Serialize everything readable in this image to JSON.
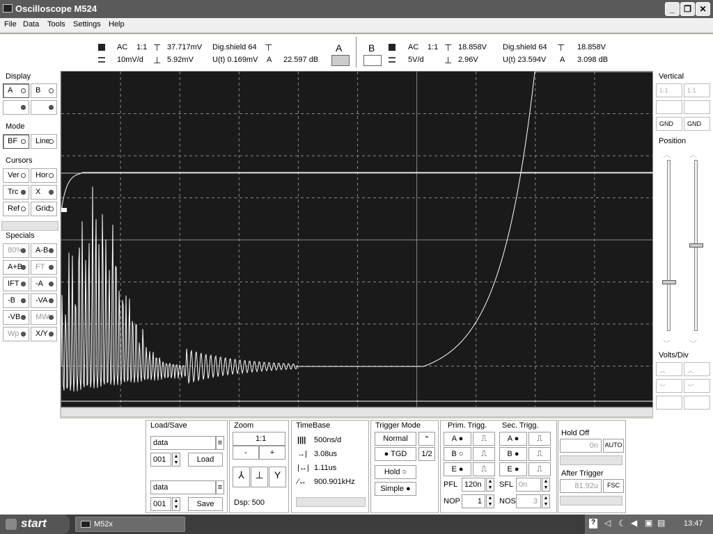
{
  "window": {
    "title": "Oscilloscope M524",
    "minimize": "_",
    "maximize": "❐",
    "close": "✕"
  },
  "menu": [
    "File",
    "Data",
    "Tools",
    "Settings",
    "Help"
  ],
  "channel_a": {
    "coupling": "AC",
    "ratio": "1:1",
    "vpp": "37.717mV",
    "shield": "Dig.shield 64",
    "volts_div": "10mV/d",
    "vrms": "5.92mV",
    "ut": "U(t) 0.169mV",
    "a_label": "A",
    "db": "22.597 dB",
    "box_label": "A"
  },
  "channel_b": {
    "box_label": "B",
    "coupling": "AC",
    "ratio": "1:1",
    "vpp": "18.858V",
    "shield": "Dig.shield 64",
    "vmax": "18.858V",
    "volts_div": "5V/d",
    "vrms": "2.96V",
    "ut": "U(t) 23.594V",
    "a_label": "A",
    "db": "3.098 dB"
  },
  "left": {
    "display": {
      "title": "Display",
      "a": "A",
      "b": "B"
    },
    "mode": {
      "title": "Mode",
      "bf": "BF",
      "line": "Line"
    },
    "cursors": {
      "title": "Cursors",
      "ver": "Ver",
      "hor": "Hor",
      "trc": "Trc",
      "x": "X",
      "ref": "Ref",
      "grid": "Grid"
    },
    "specials": {
      "title": "Specials",
      "items": [
        "80%",
        "A-B",
        "A+B",
        "FT",
        "IFT",
        "-A",
        "-B",
        "-VA",
        "-VB",
        "MW",
        "Wp",
        "X/Y"
      ]
    }
  },
  "right": {
    "vertical": {
      "title": "Vertical",
      "r1a": "1:1",
      "r1b": "1:1",
      "gnd_a": "GND",
      "gnd_b": "GND"
    },
    "position": {
      "title": "Position",
      "slider_a": 0.72,
      "slider_b": 0.5
    },
    "volts_div": {
      "title": "Volts/Div"
    }
  },
  "loadsave": {
    "title": "Load/Save",
    "file1": "data",
    "num1": "001",
    "load": "Load",
    "file2": "data",
    "num2": "001",
    "save": "Save"
  },
  "zoom": {
    "title": "Zoom",
    "ratio": "1:1",
    "minus": "-",
    "plus": "+",
    "dsp": "Dsp: 500"
  },
  "timebase": {
    "title": "TimeBase",
    "per_div": "500ns/d",
    "t1": "3.08us",
    "t2": "1.11us",
    "freq": "900.901kHz"
  },
  "trigger_mode": {
    "title": "Trigger Mode",
    "normal": "Normal",
    "tgd": "TGD",
    "half": "1/2",
    "hold": "Hold",
    "simple": "Simple"
  },
  "prim_trigg": {
    "title": "Prim. Trigg.",
    "a": "A",
    "b": "B",
    "e": "E",
    "pfl_label": "PFL",
    "pfl": "120n",
    "nop_label": "NOP",
    "nop": "1"
  },
  "sec_trigg": {
    "title": "Sec. Trigg.",
    "a": "A",
    "b": "B",
    "e": "E",
    "sfl_label": "SFL",
    "sfl": "0n",
    "nos_label": "NOS",
    "nos": "3"
  },
  "holdoff": {
    "title": "Hold Off",
    "value": "0n",
    "auto": "AUTO",
    "after_title": "After Trigger",
    "after_value": "81.92u",
    "fsc": "FSC"
  },
  "taskbar": {
    "start": "start",
    "task": "M52x",
    "clock": "13:47"
  },
  "colors": {
    "screen": "#1a1a1a",
    "grid": "#8a8a8a",
    "trace": "#ffffff",
    "taskbar": "#3c3c3c"
  }
}
